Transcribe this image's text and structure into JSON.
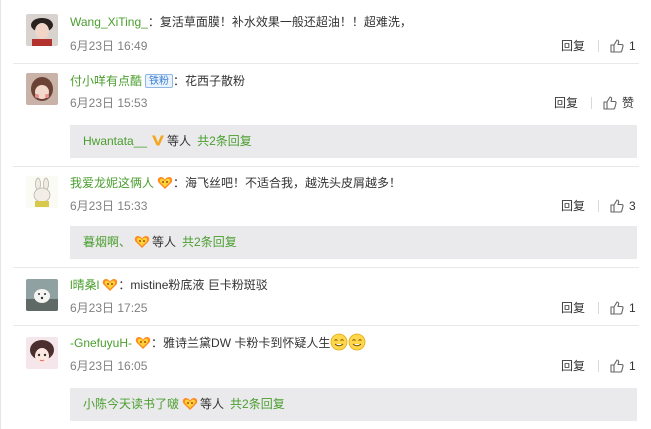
{
  "comments": [
    {
      "user": "Wang_XiTing_",
      "colon": "：",
      "text": "复活草面膜！补水效果一般还超油！！超难洗，",
      "time": "6月23日 16:49",
      "reply_label": "回复",
      "likes": "1"
    },
    {
      "user": "付小咩有点酷",
      "badge": "铁粉",
      "colon": "：",
      "text": "花西子散粉",
      "time": "6月23日 15:53",
      "reply_label": "回复",
      "likes": "赞",
      "sub": {
        "user": "Hwantata__",
        "deng": "等人",
        "more": "共2条回复"
      }
    },
    {
      "user": "我爱龙妮这俩人",
      "colon": "：",
      "text": "海飞丝吧！不适合我，越洗头皮屑越多！",
      "time": "6月23日 15:33",
      "reply_label": "回复",
      "likes": "3",
      "sub": {
        "user": "暮烟啊、",
        "deng": "等人",
        "more": "共2条回复"
      }
    },
    {
      "user": "l晴桑l",
      "colon": "：",
      "text": "mistine粉底液 巨卡粉斑驳",
      "time": "6月23日 17:25",
      "reply_label": "回复",
      "likes": "1"
    },
    {
      "user": "-GnefuyuH-",
      "colon": "：",
      "text": "雅诗兰黛DW 卡粉卡到怀疑人生",
      "time": "6月23日 16:05",
      "reply_label": "回复",
      "likes": "1",
      "sub": {
        "user": "小陈今天读书了啵",
        "deng": "等人",
        "more": "共2条回复"
      }
    }
  ],
  "colors": {
    "username": "#4a9e2e",
    "meta": "#808080",
    "subbg": "#eaeaec"
  },
  "icons": [
    "thumb-up-icon",
    "vip-v-icon",
    "fan-heart-icon",
    "smile-emoji-icon"
  ]
}
